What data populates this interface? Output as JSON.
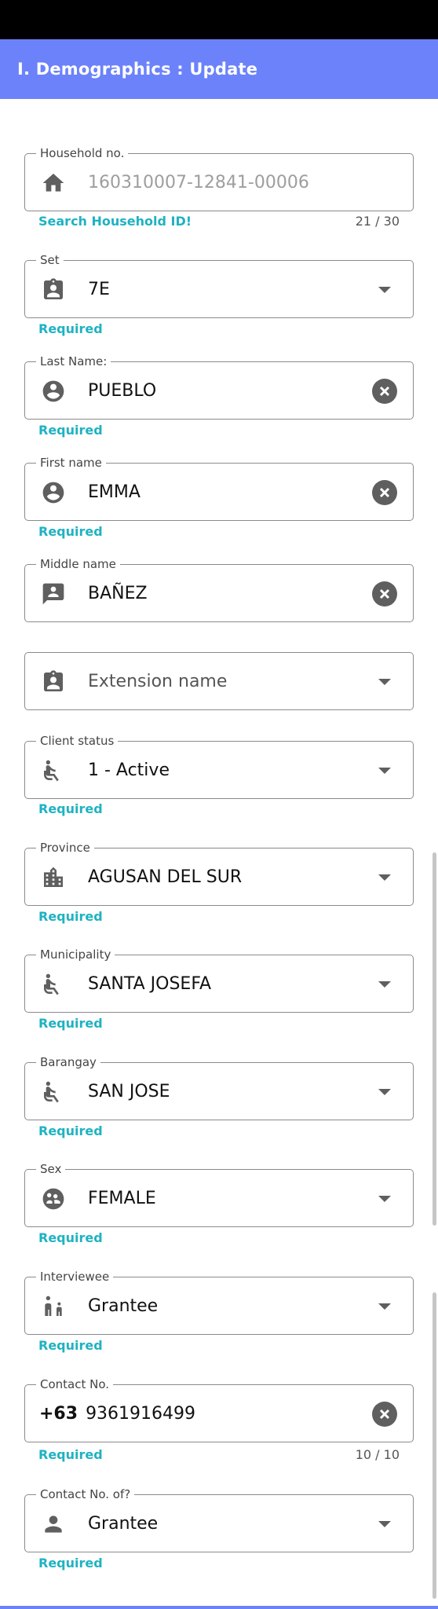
{
  "app_bar": {
    "title": "I. Demographics : Update"
  },
  "fields": {
    "household": {
      "label": "Household no.",
      "value": "160310007-12841-00006",
      "helper": "Search Household ID!",
      "counter": "21 / 30"
    },
    "set": {
      "label": "Set",
      "value": "7E",
      "helper": "Required"
    },
    "last_name": {
      "label": "Last Name:",
      "value": "PUEBLO",
      "helper": "Required"
    },
    "first_name": {
      "label": "First name",
      "value": "EMMA",
      "helper": "Required"
    },
    "middle_name": {
      "label": "Middle name",
      "value": "BAÑEZ"
    },
    "extension_name": {
      "placeholder": "Extension name"
    },
    "client_status": {
      "label": "Client status",
      "value": "1 - Active",
      "helper": "Required"
    },
    "province": {
      "label": "Province",
      "value": "AGUSAN DEL SUR",
      "helper": "Required"
    },
    "municipality": {
      "label": "Municipality",
      "value": "SANTA JOSEFA",
      "helper": "Required"
    },
    "barangay": {
      "label": "Barangay",
      "value": "SAN JOSE",
      "helper": "Required"
    },
    "sex": {
      "label": "Sex",
      "value": "FEMALE",
      "helper": "Required"
    },
    "interviewee": {
      "label": "Interviewee",
      "value": "Grantee",
      "helper": "Required"
    },
    "contact_no": {
      "label": "Contact No.",
      "prefix": "+63",
      "value": "9361916499",
      "helper": "Required",
      "counter": "10 / 10"
    },
    "contact_no_of": {
      "label": "Contact No. of?",
      "value": "Grantee",
      "helper": "Required"
    }
  },
  "icons": {
    "household": "home-icon",
    "set": "badge-icon",
    "last_name": "account-circle-icon",
    "first_name": "account-circle-icon",
    "middle_name": "contact-card-icon",
    "extension_name": "badge-icon",
    "client_status": "accessible-icon",
    "province": "city-icon",
    "municipality": "accessible-icon",
    "barangay": "accessible-icon",
    "sex": "face-icon",
    "interviewee": "family-icon",
    "contact_no_of": "person-icon"
  },
  "colors": {
    "accent": "#6b82fa",
    "helper": "#1fb2c2",
    "icon": "#5f5f5f"
  }
}
